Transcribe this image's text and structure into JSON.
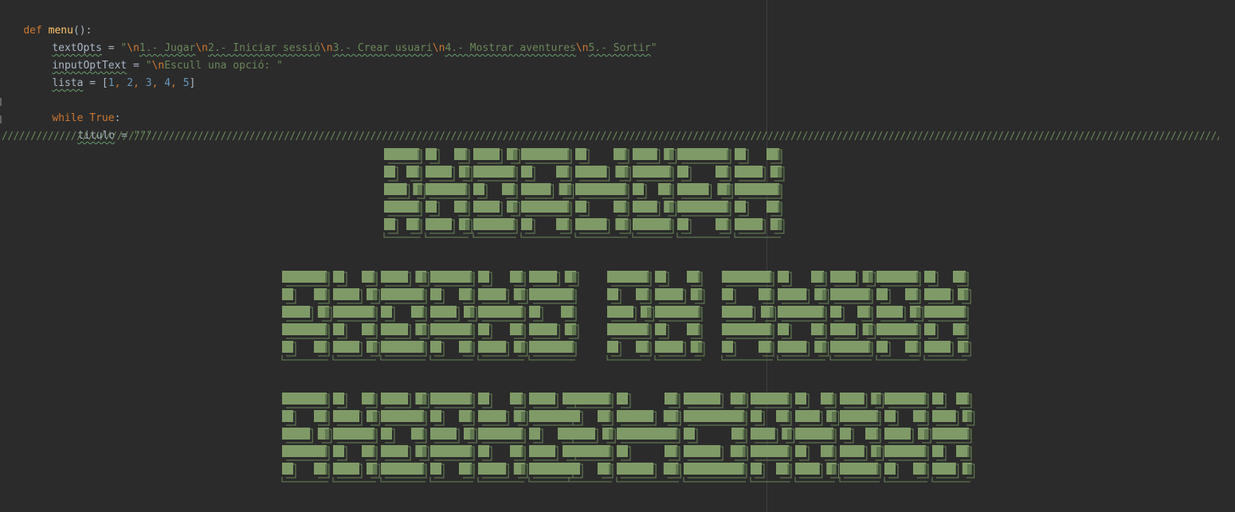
{
  "code": {
    "line1": {
      "kw": "def",
      "fn": "menu",
      "rest": "():"
    },
    "line2": {
      "var": "textOpts",
      "eq": " = ",
      "q1": "\"",
      "parts": [
        {
          "esc": "\\n",
          "txt": "1.- Jugar"
        },
        {
          "esc": "\\n",
          "txt": "2.- Iniciar sessió"
        },
        {
          "esc": "\\n",
          "txt": "3.- Crear usuari"
        },
        {
          "esc": "\\n",
          "txt": "4.- Mostrar aventures"
        },
        {
          "esc": "\\n",
          "txt": "5.- Sortir"
        }
      ],
      "q2": "\""
    },
    "line3": {
      "var": "inputOptText",
      "eq": " = ",
      "str_open": "\"",
      "esc": "\\n",
      "txt": "Escull una opció: \""
    },
    "line4": {
      "var": "lista",
      "eq": " = [",
      "nums": [
        "1",
        "2",
        "3",
        "4",
        "5"
      ],
      "close": "]"
    },
    "line6": {
      "kw1": "while",
      "kw2": "True",
      "colon": ":"
    },
    "line7": {
      "var": "titulo",
      "eq": " = ",
      "str": "\"\"\""
    }
  },
  "separator": "////////////////////////////////////////////////////////////////////////////////////////////////////////////////////////////////////////////////////////////////////////////////////////////////////////////////////////////////////////////////////////////////",
  "banner": {
    "rows": [
      {
        "id": "word1",
        "glyph_count": 8
      },
      {
        "id": "word2a",
        "glyph_count": 6
      },
      {
        "id": "word2b",
        "glyph_count": 2
      },
      {
        "id": "word2c",
        "glyph_count": 5
      },
      {
        "id": "word3a",
        "glyph_count": 6
      },
      {
        "id": "word3b",
        "glyph_count": 8
      }
    ]
  },
  "colors": {
    "background": "#2b2b2b",
    "keyword": "#cc7832",
    "function": "#ffc66d",
    "string": "#6a8759",
    "number": "#6897bb",
    "text": "#a9b7c6"
  }
}
